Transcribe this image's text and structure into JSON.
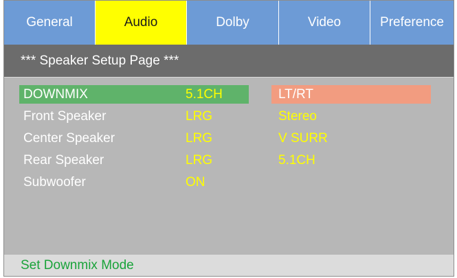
{
  "tabs": [
    {
      "label": "General"
    },
    {
      "label": "Audio"
    },
    {
      "label": "Dolby"
    },
    {
      "label": "Video"
    },
    {
      "label": "Preference"
    }
  ],
  "active_tab": "Audio",
  "header": {
    "title": "***  Speaker Setup Page ***"
  },
  "settings": [
    {
      "label": "DOWNMIX",
      "value": "5.1CH"
    },
    {
      "label": "Front Speaker",
      "value": "LRG"
    },
    {
      "label": "Center Speaker",
      "value": "LRG"
    },
    {
      "label": "Rear Speaker",
      "value": "LRG"
    },
    {
      "label": "Subwoofer",
      "value": "ON"
    }
  ],
  "selected_setting": "DOWNMIX",
  "options": [
    {
      "label": "LT/RT"
    },
    {
      "label": "Stereo"
    },
    {
      "label": "V SURR"
    },
    {
      "label": "5.1CH"
    }
  ],
  "highlighted_option": "LT/RT",
  "footer": {
    "hint": "Set Downmix Mode"
  },
  "colors": {
    "tab_bar": "#6d9bd6",
    "active_tab": "#ffff00",
    "header_bar": "#6c6c6c",
    "content_bg": "#b7b7b7",
    "selected_row": "#5fb36a",
    "highlighted_option": "#f29c80",
    "value_text": "#ffff00",
    "footer_text": "#1aa33a"
  }
}
